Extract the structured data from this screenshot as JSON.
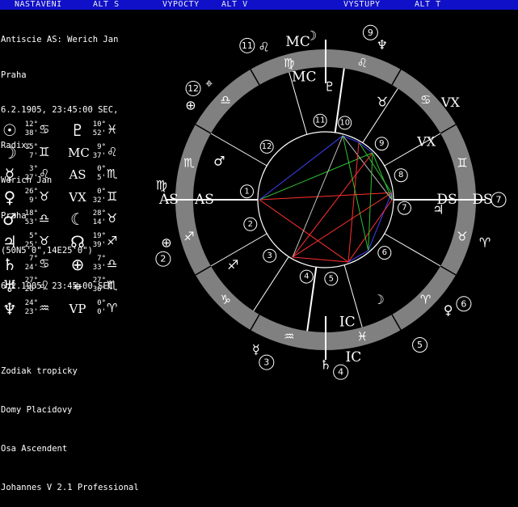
{
  "menu": [
    {
      "label": "NASTAVENI"
    },
    {
      "label": "ALT S"
    },
    {
      "label": "VYPOCTY"
    },
    {
      "label": "ALT V"
    },
    {
      "label": "VYSTUPY"
    },
    {
      "label": "ALT T"
    }
  ],
  "info": {
    "line1": "Antiscie AS: Werich Jan",
    "line2": "Praha",
    "line3": "6.2.1905, 23:45:00 SEC,",
    "line4": "Radix:",
    "line5": "Werich Jan",
    "line6": "Praha",
    "line7": "(50N5'0\",14E25'0\")",
    "line8": "6.2.1905, 23:45:00 SEC"
  },
  "positions": [
    {
      "glyph": "☉",
      "deg": "12°",
      "min": "38'",
      "sign": "♋",
      "icon": "sun-icon"
    },
    {
      "glyph": "♇",
      "deg": "10°",
      "min": "52'",
      "sign": "♓",
      "icon": "pluto-icon"
    },
    {
      "glyph": "☽",
      "deg": "15°",
      "min": "7'",
      "sign": "♊",
      "icon": "moon-icon"
    },
    {
      "glyph": "MC",
      "deg": "9°",
      "min": "37'",
      "sign": "♌",
      "icon": "mc-icon"
    },
    {
      "glyph": "☿",
      "deg": "3°",
      "min": "27'",
      "sign": "♌",
      "icon": "mercury-icon"
    },
    {
      "glyph": "AS",
      "deg": "0°",
      "min": "5'",
      "sign": "♏",
      "icon": "ascendant-icon"
    },
    {
      "glyph": "♀",
      "deg": "26°",
      "min": "9'",
      "sign": "♉",
      "icon": "venus-icon"
    },
    {
      "glyph": "VX",
      "deg": "0°",
      "min": "32'",
      "sign": "♊",
      "icon": "vertex-icon"
    },
    {
      "glyph": "♂",
      "deg": "18°",
      "min": "53'",
      "sign": "♎",
      "icon": "mars-icon"
    },
    {
      "glyph": "☾",
      "deg": "28°",
      "min": "14'",
      "sign": "♉",
      "icon": "lilith-icon"
    },
    {
      "glyph": "♃",
      "deg": "5°",
      "min": "25'",
      "sign": "♉",
      "icon": "jupiter-icon"
    },
    {
      "glyph": "☊",
      "deg": "19°",
      "min": "39'",
      "sign": "♐",
      "icon": "node-icon"
    },
    {
      "glyph": "♄",
      "deg": "7°",
      "min": "24'",
      "sign": "♋",
      "icon": "saturn-icon"
    },
    {
      "glyph": "⊕",
      "deg": "7°",
      "min": "33'",
      "sign": "♎",
      "icon": "fortune-icon"
    },
    {
      "glyph": "♅",
      "deg": "27°",
      "min": "26'",
      "sign": "♌",
      "icon": "uranus-icon"
    },
    {
      "glyph": "⌖",
      "deg": "27°",
      "min": "36'",
      "sign": "♏",
      "icon": "point-icon"
    },
    {
      "glyph": "♆",
      "deg": "24°",
      "min": "23'",
      "sign": "♒",
      "icon": "neptune-icon"
    },
    {
      "glyph": "VP",
      "deg": "0°",
      "min": "0'",
      "sign": "♈",
      "icon": "vernal-point-icon"
    }
  ],
  "footer": {
    "zodiac": "Zodiak tropicky",
    "houses": "Domy Placidovy",
    "axis": "Osa Ascendent",
    "version": "Johannes V 2.1 Professional"
  },
  "wheel": {
    "outer_signs": [
      "♏",
      "♎",
      "♍",
      "♌",
      "♋",
      "♊",
      "♉",
      "♈",
      "♓",
      "♒",
      "♑",
      "♐"
    ],
    "cusp_numbers": [
      "1",
      "2",
      "3",
      "4",
      "5",
      "6",
      "7",
      "8",
      "9",
      "10",
      "11",
      "12"
    ],
    "axis_labels": {
      "as": "AS",
      "ds": "DS",
      "mc": "MC",
      "ic": "IC",
      "vx": "VX"
    },
    "outer_planets": [
      {
        "glyph": "♆",
        "num": "9"
      },
      {
        "glyph": "♇",
        "num": ""
      },
      {
        "glyph": "♌",
        "num": "11"
      },
      {
        "glyph": "☽",
        "num": ""
      },
      {
        "glyph": "♉",
        "num": ""
      },
      {
        "glyph": "⌖",
        "num": "12"
      },
      {
        "glyph": "⊕",
        "num": ""
      },
      {
        "glyph": "♂",
        "num": ""
      },
      {
        "glyph": "♍",
        "num": ""
      },
      {
        "glyph": "⊕",
        "num": "2"
      },
      {
        "glyph": "♐",
        "num": ""
      },
      {
        "glyph": "☿",
        "num": "3"
      },
      {
        "glyph": "♄",
        "num": "4"
      },
      {
        "glyph": "☽",
        "num": "5"
      },
      {
        "glyph": "♀",
        "num": "6"
      },
      {
        "glyph": "♈",
        "num": ""
      },
      {
        "glyph": "♃",
        "num": "7"
      }
    ]
  },
  "colors": {
    "menubar": "#1010c8",
    "ring": "#808080",
    "background": "#000000",
    "text": "#ffffff"
  }
}
